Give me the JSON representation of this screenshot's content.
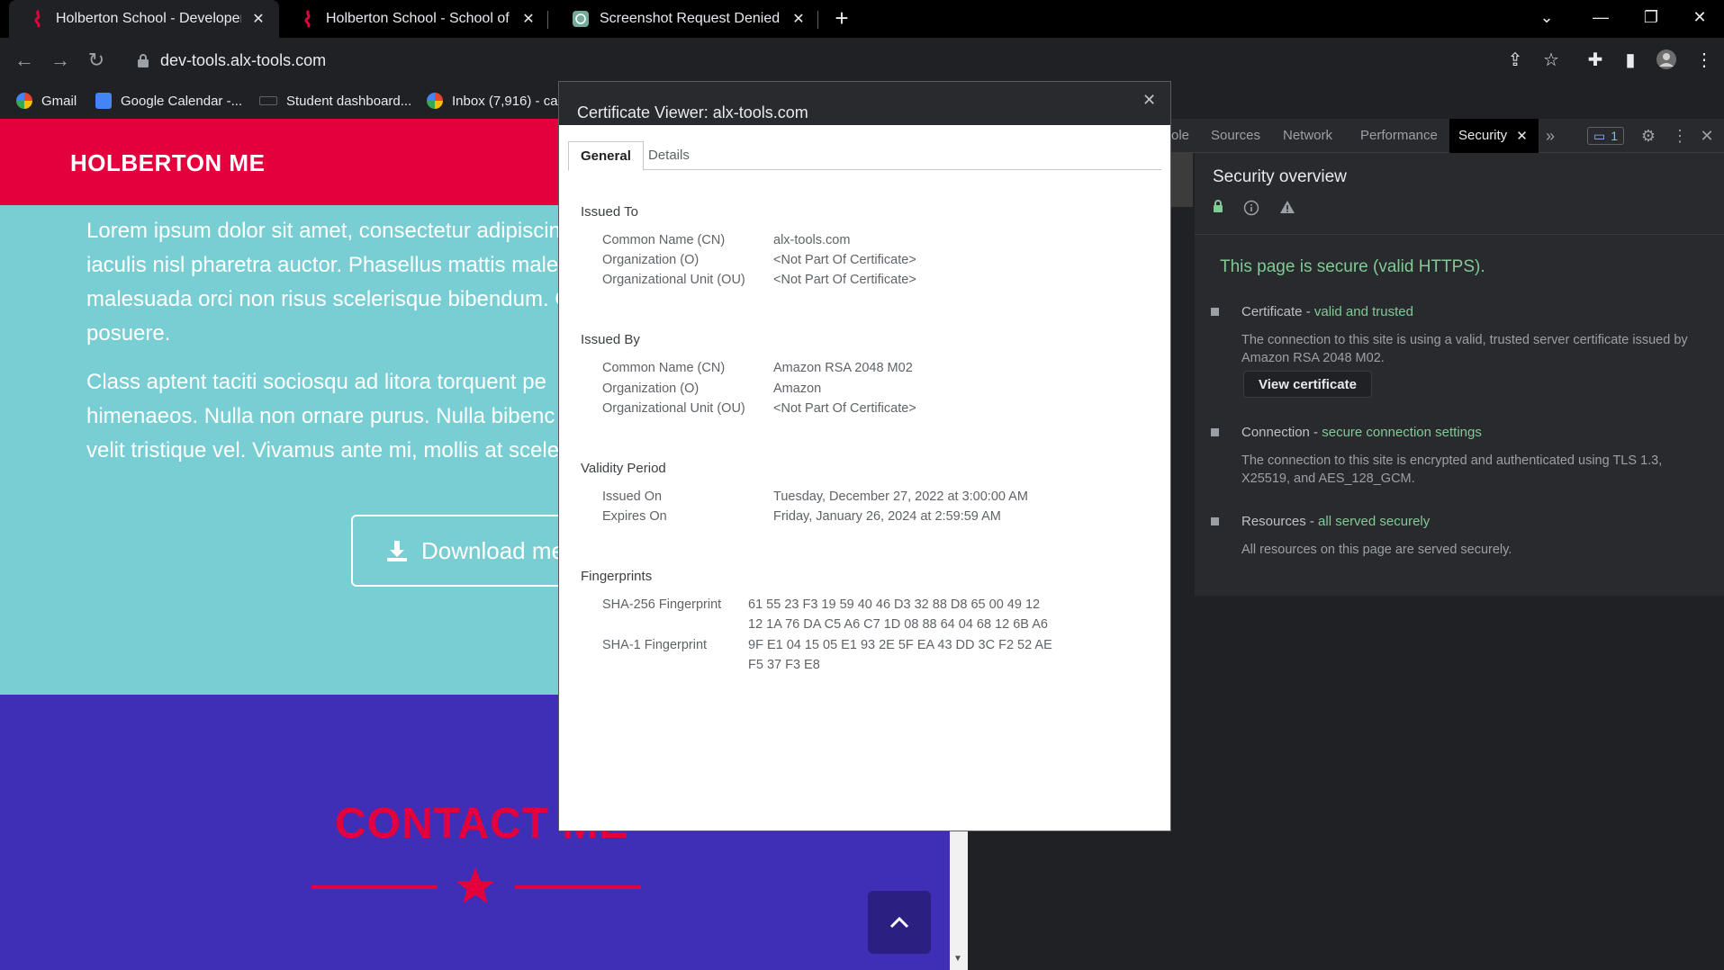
{
  "browser": {
    "tabs": [
      {
        "title": "Holberton School - Developer to",
        "active": true
      },
      {
        "title": "Holberton School - School of Co",
        "active": false
      },
      {
        "title": "Screenshot Request Denied",
        "active": false
      }
    ],
    "url": "dev-tools.alx-tools.com",
    "bookmarks": [
      "Gmail",
      "Google Calendar -...",
      "Student dashboard...",
      "Inbox (7,916) - ca"
    ]
  },
  "page": {
    "header_title": "HOLBERTON ME",
    "paragraph1": [
      "Lorem ipsum dolor sit amet, consectetur adipiscing",
      "iaculis nisl pharetra auctor. Phasellus mattis male",
      "malesuada orci non risus scelerisque bibendum. C",
      "posuere."
    ],
    "paragraph2": [
      "Class aptent taciti sociosqu ad litora torquent pe",
      "himenaeos. Nulla non ornare purus. Nulla bibenc",
      "velit tristique vel. Vivamus ante mi, mollis at scele"
    ],
    "download_label": "Download me",
    "contact_title": "CONTACT ME",
    "colors": {
      "header": "#e3003c",
      "teal": "#78ced2",
      "purple": "#3f2fb6"
    }
  },
  "devtools": {
    "tabs": [
      "ole",
      "Sources",
      "Network",
      "Performance",
      "Security"
    ],
    "active_tab": "Security",
    "issues_count": "1",
    "security_overview_title": "Security overview",
    "secure_message": "This page is secure (valid HTTPS).",
    "items": [
      {
        "label": "Certificate",
        "status": "valid and trusted",
        "desc": "The connection to this site is using a valid, trusted server certificate issued by Amazon RSA 2048 M02."
      },
      {
        "label": "Connection",
        "status": "secure connection settings",
        "desc": "The connection to this site is encrypted and authenticated using TLS 1.3, X25519, and AES_128_GCM."
      },
      {
        "label": "Resources",
        "status": "all served securely",
        "desc": "All resources on this page are served securely."
      }
    ],
    "view_certificate_label": "View certificate",
    "dash": " - "
  },
  "certificate": {
    "title": "Certificate Viewer: alx-tools.com",
    "tabs": [
      "General",
      "Details"
    ],
    "issued_to": {
      "heading": "Issued To",
      "rows": [
        {
          "label": "Common Name (CN)",
          "value": "alx-tools.com"
        },
        {
          "label": "Organization (O)",
          "value": "<Not Part Of Certificate>"
        },
        {
          "label": "Organizational Unit (OU)",
          "value": "<Not Part Of Certificate>"
        }
      ]
    },
    "issued_by": {
      "heading": "Issued By",
      "rows": [
        {
          "label": "Common Name (CN)",
          "value": "Amazon RSA 2048 M02"
        },
        {
          "label": "Organization (O)",
          "value": "Amazon"
        },
        {
          "label": "Organizational Unit (OU)",
          "value": "<Not Part Of Certificate>"
        }
      ]
    },
    "validity": {
      "heading": "Validity Period",
      "rows": [
        {
          "label": "Issued On",
          "value": "Tuesday, December 27, 2022 at 3:00:00 AM"
        },
        {
          "label": "Expires On",
          "value": "Friday, January 26, 2024 at 2:59:59 AM"
        }
      ]
    },
    "fingerprints": {
      "heading": "Fingerprints",
      "sha256_label": "SHA-256 Fingerprint",
      "sha256_line1": "61 55 23 F3 19 59 40 46 D3 32 88 D8 65 00 49 12",
      "sha256_line2": "12 1A 76 DA C5 A6 C7 1D 08 88 64 04 68 12 6B A6",
      "sha1_label": "SHA-1 Fingerprint",
      "sha1_line1": "9F E1 04 15 05 E1 93 2E 5F EA 43 DD 3C F2 52 AE",
      "sha1_line2": "F5 37 F3 E8"
    }
  }
}
